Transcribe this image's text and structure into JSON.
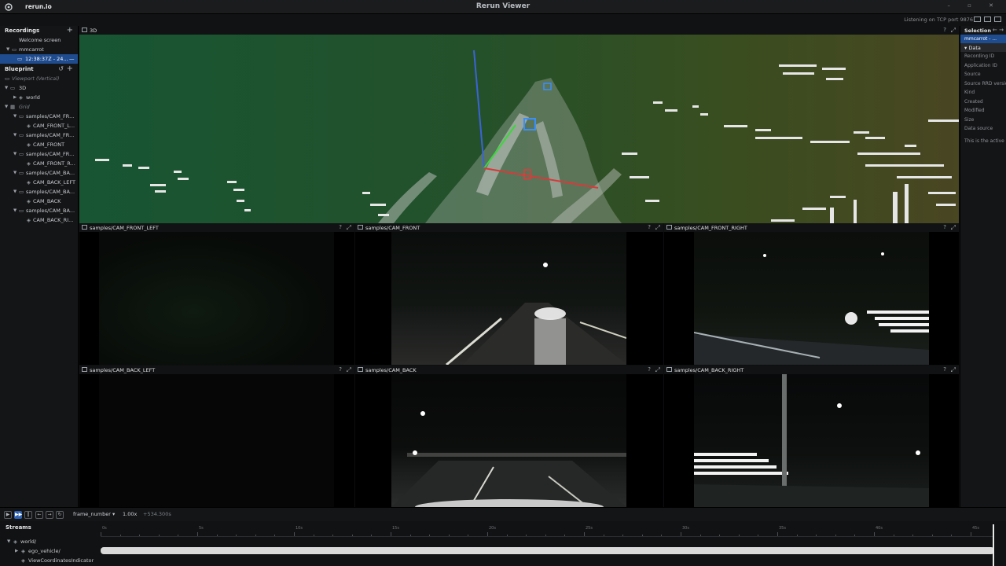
{
  "window": {
    "title": "Rerun Viewer",
    "app_label": "rerun.io",
    "controls": "– ▫ ✕"
  },
  "topbar": {
    "status": "Listening on TCP port 9876"
  },
  "recordings": {
    "header": "Recordings",
    "welcome": "Welcome screen",
    "app": "mmcarrot",
    "recording": "12:38:37Z - 24..."
  },
  "blueprint": {
    "header": "Blueprint",
    "viewport": "Viewport (Vertical)",
    "view3d": "3D",
    "world": "world",
    "grid": "Grid",
    "views": [
      {
        "view": "samples/CAM_FR...",
        "entity": "CAM_FRONT_L..."
      },
      {
        "view": "samples/CAM_FR...",
        "entity": "CAM_FRONT"
      },
      {
        "view": "samples/CAM_FR...",
        "entity": "CAM_FRONT_R..."
      },
      {
        "view": "samples/CAM_BA...",
        "entity": "CAM_BACK_LEFT"
      },
      {
        "view": "samples/CAM_BA...",
        "entity": "CAM_BACK"
      },
      {
        "view": "samples/CAM_BA...",
        "entity": "CAM_BACK_RI..."
      }
    ]
  },
  "view3d": {
    "title": "3D"
  },
  "cameras": [
    {
      "title": "samples/CAM_FRONT_LEFT"
    },
    {
      "title": "samples/CAM_FRONT"
    },
    {
      "title": "samples/CAM_FRONT_RIGHT"
    },
    {
      "title": "samples/CAM_BACK_LEFT"
    },
    {
      "title": "samples/CAM_BACK"
    },
    {
      "title": "samples/CAM_BACK_RIGHT"
    }
  ],
  "selection": {
    "header": "Selection",
    "nav": "← →",
    "item": "mmcarrot - ...",
    "data_header": "Data",
    "fields": [
      "Recording ID",
      "Application ID",
      "Source",
      "Source RRD version",
      "Kind",
      "Created",
      "Modified",
      "Size",
      "Data source"
    ],
    "info": "This is the active r..."
  },
  "timeline": {
    "timeline_name": "frame_number",
    "speed": "1.00x",
    "time_offset": "+534.300s",
    "tick_labels": [
      "0s",
      "5s",
      "10s",
      "15s",
      "20s",
      "25s",
      "30s",
      "35s",
      "40s",
      "45s"
    ]
  },
  "streams": {
    "header": "Streams",
    "items": [
      "world/",
      "ego_vehicle/",
      "ViewCoordinatesIndicator"
    ]
  }
}
